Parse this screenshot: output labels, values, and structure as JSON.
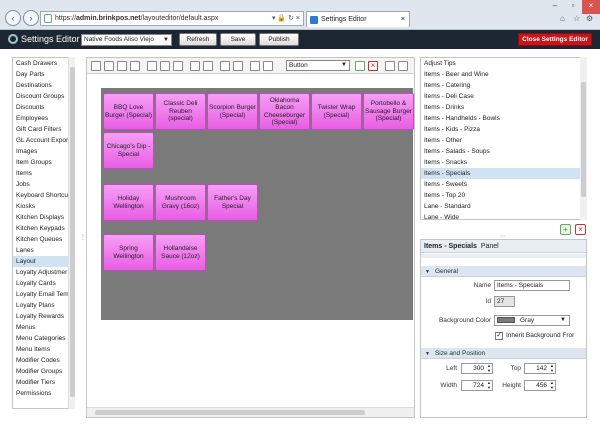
{
  "browser": {
    "url_prefix": "https://",
    "url_domain": "admin.brinkpos.net",
    "url_path": "/layouteditor/default.aspx",
    "tab_title": "Settings Editor",
    "address_actions": "▾ 🔒 ↻ ×"
  },
  "app": {
    "title": "Settings Editor",
    "location": "Native Foods Aliso Viejo",
    "refresh_label": "Refresh",
    "save_label": "Save",
    "publish_label": "Publish",
    "close_label": "Close Settings Editor"
  },
  "left_list": {
    "items": [
      "Cash Drawers",
      "Day Parts",
      "Destinations",
      "Discount Groups",
      "Discounts",
      "Employees",
      "Gift Card Filters",
      "GL Account Expor",
      "Images",
      "Item Groups",
      "Items",
      "Jobs",
      "Keyboard Shortcu",
      "Kiosks",
      "Kitchen Displays",
      "Kitchen Keypads",
      "Kitchen Queues",
      "Lanes",
      "Layout",
      "Loyalty Adjustmer",
      "Loyalty Cards",
      "Loyalty Email Tem",
      "Loyalty Plans",
      "Loyalty Rewards",
      "Menus",
      "Menu Categories",
      "Menu Items",
      "Modifier Codes",
      "Modifier Groups",
      "Modifier Tiers",
      "Permissions"
    ],
    "selected": "Layout"
  },
  "toolbar": {
    "type_select": "Button"
  },
  "canvas": {
    "buttons": [
      "BBQ Love Burger (Special)",
      "Classic Deli Reuben (special)",
      "Scorpion Burger (Special)",
      "Oklahoma Bacon Cheeseburger (Special)",
      "Twister Wrap (Special)",
      "Portobello & Sausage Burger (Special)",
      "Chicago's Dip - Special",
      "Holiday Wellington",
      "Mushroom Gravy (16oz)",
      "Father's Day Special",
      "Spring Wellington",
      "Hollandaise Sauce (12oz)"
    ]
  },
  "right_list": {
    "items": [
      "Adjust Tips",
      "Items - Beer and Wine",
      "Items - Catering",
      "Items - Deli Case",
      "Items - Drinks",
      "Items - Handhelds - Bowls",
      "Items - Kids - Pizza",
      "Items - Other",
      "Items - Salads - Soups",
      "Items - Snacks",
      "Items - Specials",
      "Items - Sweets",
      "Items - Top 20",
      "Lane - Standard",
      "Lane - Wide"
    ],
    "selected": "Items - Specials"
  },
  "properties": {
    "header_name": "Items - Specials",
    "header_suffix": "Panel",
    "general_label": "General",
    "name_label": "Name",
    "name_value": "Items - Specials",
    "id_label": "Id",
    "id_value": "27",
    "bg_label": "Background Color",
    "bg_value": "Gray",
    "bg_swatch": "#7a7a7a",
    "inherit_label": "Inherit Background Fror",
    "size_label": "Size and Position",
    "left_label": "Left",
    "left_value": "300",
    "top_label": "Top",
    "top_value": "142",
    "width_label": "Width",
    "width_value": "724",
    "height_label": "Height",
    "height_value": "456"
  },
  "colors": {
    "button_pink": "#f07cee",
    "close_red": "#c8141b",
    "topbar": "#1d2733"
  }
}
